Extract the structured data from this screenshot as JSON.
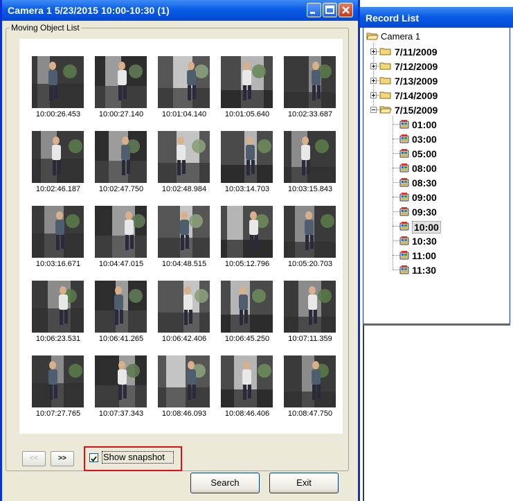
{
  "window": {
    "title": "Camera 1 5/23/2015 10:00-10:30 (1)",
    "group_label": "Moving Object List"
  },
  "thumbnails": [
    "10:00:26.453",
    "10:00:27.140",
    "10:01:04.140",
    "10:01:05.640",
    "10:02:33.687",
    "10:02:46.187",
    "10:02:47.750",
    "10:02:48.984",
    "10:03:14.703",
    "10:03:15.843",
    "10:03:16.671",
    "10:04:47.015",
    "10:04:48.515",
    "10:05:12.796",
    "10:05:20.703",
    "10:06:23.531",
    "10:06:41.265",
    "10:06:42.406",
    "10:06:45.250",
    "10:07:11.359",
    "10:07:27.765",
    "10:07:37.343",
    "10:08:46.093",
    "10:08:46.406",
    "10:08:47.750"
  ],
  "controls": {
    "prev_label": "<<",
    "next_label": ">>",
    "show_snapshot_label": "Show snapshot",
    "show_snapshot_checked": true,
    "search_label": "Search",
    "exit_label": "Exit"
  },
  "record_list": {
    "title": "Record List",
    "root": "Camera 1",
    "dates": [
      "7/11/2009",
      "7/12/2009",
      "7/13/2009",
      "7/14/2009",
      "7/15/2009"
    ],
    "expanded_date": "7/15/2009",
    "times": [
      "01:00",
      "03:00",
      "05:00",
      "08:00",
      "08:30",
      "09:00",
      "09:30",
      "10:00",
      "10:30",
      "11:00",
      "11:30"
    ],
    "selected_time": "10:00"
  },
  "colors": {
    "title_bar": "#0a5ce4",
    "window_border": "#0831d9",
    "highlight_box": "#e01010",
    "dialog_bg": "#ece9d8"
  }
}
